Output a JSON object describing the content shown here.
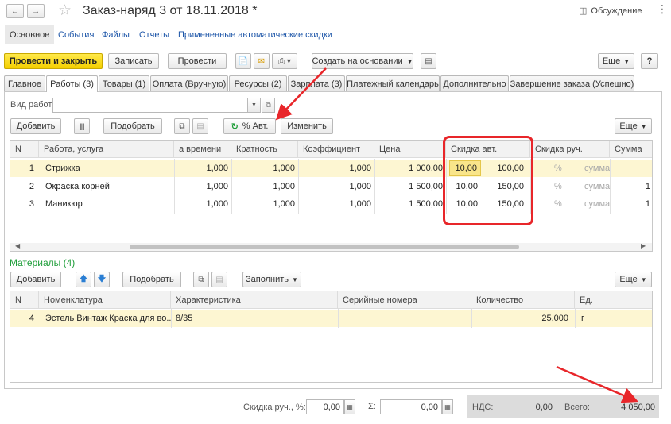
{
  "window": {
    "title": "Заказ-наряд 3 от 18.11.2018 *",
    "discussion": "Обсуждение"
  },
  "nav": {
    "main": "Основное",
    "links": [
      "События",
      "Файлы",
      "Отчеты",
      "Примененные автоматические скидки"
    ]
  },
  "toolbar": {
    "post_close": "Провести и закрыть",
    "save": "Записать",
    "post": "Провести",
    "create_based": "Создать на основании",
    "more": "Еще",
    "help": "?"
  },
  "tabs": [
    "Главное",
    "Работы (3)",
    "Товары (1)",
    "Оплата (Вручную)",
    "Ресурсы (2)",
    "Зарплата (3)",
    "Платежный календарь",
    "Дополнительно",
    "Завершение заказа (Успешно)"
  ],
  "works": {
    "kind_label": "Вид работ:",
    "kind_value": "",
    "add": "Добавить",
    "pick": "Подобрать",
    "auto_discount": "% Авт.",
    "change": "Изменить",
    "more": "Еще",
    "columns": [
      "N",
      "Работа, услуга",
      "а времени",
      "Кратность",
      "Коэффициент",
      "Цена",
      "Скидка авт.",
      "Скидка руч.",
      "Сумма"
    ],
    "rows": [
      {
        "n": "1",
        "name": "Стрижка",
        "time": "1,000",
        "mult": "1,000",
        "coef": "1,000",
        "price": "1 000,00",
        "disc_pct": "10,00",
        "disc_sum": "100,00",
        "man_pct": "%",
        "man_sum": "сумма",
        "sum": ""
      },
      {
        "n": "2",
        "name": "Окраска корней",
        "time": "1,000",
        "mult": "1,000",
        "coef": "1,000",
        "price": "1 500,00",
        "disc_pct": "10,00",
        "disc_sum": "150,00",
        "man_pct": "%",
        "man_sum": "сумма",
        "sum": "1"
      },
      {
        "n": "3",
        "name": "Маникюр",
        "time": "1,000",
        "mult": "1,000",
        "coef": "1,000",
        "price": "1 500,00",
        "disc_pct": "10,00",
        "disc_sum": "150,00",
        "man_pct": "%",
        "man_sum": "сумма",
        "sum": "1"
      }
    ]
  },
  "materials": {
    "title": "Материалы (4)",
    "add": "Добавить",
    "pick": "Подобрать",
    "fill": "Заполнить",
    "more": "Еще",
    "columns": [
      "N",
      "Номенклатура",
      "Характеристика",
      "Серийные номера",
      "Количество",
      "Ед."
    ],
    "rows": [
      {
        "n": "4",
        "name": "Эстель Винтаж Краска для во...",
        "char": "8/35",
        "serial": "",
        "qty": "25,000",
        "unit": "г"
      }
    ]
  },
  "footer": {
    "manual_discount_label": "Скидка руч., %:",
    "manual_discount_value": "0,00",
    "sigma_label": "Σ:",
    "sigma_value": "0,00",
    "vat_label": "НДС:",
    "vat_value": "0,00",
    "total_label": "Всего:",
    "total_value": "4 050,00"
  },
  "colors": {
    "accent_yellow": "#f4cf00",
    "selected_row": "#fdf6d2",
    "highlight_red": "#e8262a",
    "link_blue": "#1c55a8",
    "section_green": "#1f9e3a"
  }
}
